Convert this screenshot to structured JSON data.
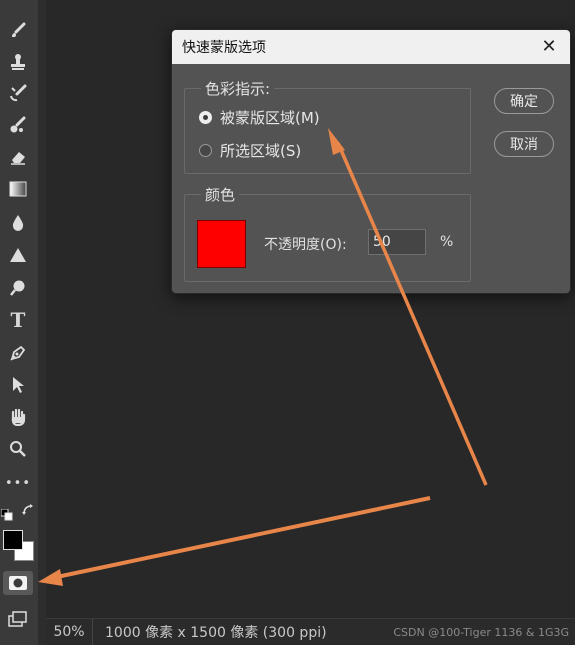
{
  "toolbar": {
    "tools": [
      {
        "id": "brush",
        "icon": "brush-icon"
      },
      {
        "id": "clone-stamp",
        "icon": "stamp-icon"
      },
      {
        "id": "history-brush",
        "icon": "history-brush-icon"
      },
      {
        "id": "mixer-brush",
        "icon": "mixer-brush-icon"
      },
      {
        "id": "eraser",
        "icon": "eraser-icon"
      },
      {
        "id": "gradient",
        "icon": "gradient-icon"
      },
      {
        "id": "blur",
        "icon": "drop-icon"
      },
      {
        "id": "sharpen",
        "icon": "triangle-icon"
      },
      {
        "id": "dodge",
        "icon": "dodge-icon"
      },
      {
        "id": "type",
        "icon": "text-icon",
        "label": "T"
      },
      {
        "id": "pen",
        "icon": "pen-icon"
      },
      {
        "id": "path-selection",
        "icon": "arrow-select-icon"
      },
      {
        "id": "hand",
        "icon": "hand-icon"
      },
      {
        "id": "zoom",
        "icon": "magnifier-icon"
      },
      {
        "id": "more",
        "icon": "more-icon",
        "label": "•••"
      },
      {
        "id": "quick-mask",
        "icon": "quick-mask-icon"
      },
      {
        "id": "screen-mode",
        "icon": "screen-mode-icon"
      }
    ],
    "foreground_color": "#000000",
    "background_color": "#ffffff"
  },
  "dialog": {
    "title": "快速蒙版选项",
    "color_indicates": {
      "legend": "色彩指示:",
      "options": [
        {
          "label": "被蒙版区域(M)",
          "checked": true
        },
        {
          "label": "所选区域(S)",
          "checked": false
        }
      ]
    },
    "color_group": {
      "legend": "颜色",
      "swatch_color": "#ff0000",
      "opacity_label": "不透明度(O):",
      "opacity_value": "50",
      "opacity_unit": "%"
    },
    "buttons": {
      "ok": "确定",
      "cancel": "取消"
    }
  },
  "status": {
    "zoom": "50%",
    "doc_info": "1000 像素 x 1500 像素 (300 ppi)",
    "watermark": "CSDN @100-Tiger 1136 & 1G3G"
  },
  "annotation_colors": {
    "arrow": "#e8864a"
  }
}
